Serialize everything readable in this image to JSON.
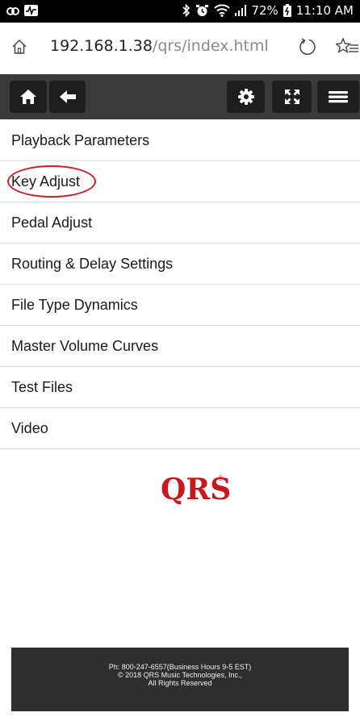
{
  "status_bar": {
    "battery": "72%",
    "time": "11:10 AM"
  },
  "browser": {
    "url_host": "192.168.1.38",
    "url_path": "/qrs/index.html"
  },
  "menu": {
    "items": [
      {
        "label": "Playback Parameters"
      },
      {
        "label": "Key Adjust"
      },
      {
        "label": "Pedal Adjust"
      },
      {
        "label": "Routing & Delay Settings"
      },
      {
        "label": "File Type Dynamics"
      },
      {
        "label": "Master Volume Curves"
      },
      {
        "label": "Test Files"
      },
      {
        "label": "Video"
      }
    ]
  },
  "logo": {
    "text": "QRS",
    "mark": "®"
  },
  "footer": {
    "line1": "Ph: 800-247-6557(Business Hours 9-5 EST)",
    "line2": "© 2018 QRS Music Technologies, Inc.,",
    "line3": "All Rights Reserved"
  },
  "colors": {
    "accent": "#c8181e",
    "toolbar": "#3a3a3a",
    "footer": "#2e2e2e"
  }
}
